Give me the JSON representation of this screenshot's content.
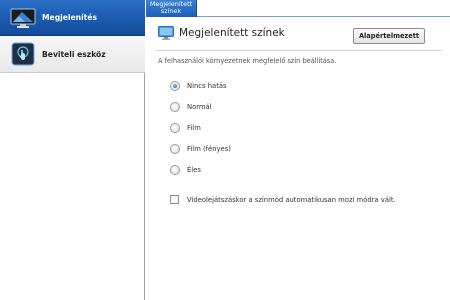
{
  "sidebar": {
    "items": [
      {
        "label": "Megjelenítés",
        "icon": "display-icon",
        "active": true
      },
      {
        "label": "Beviteli eszköz",
        "icon": "touch-input-icon",
        "active": false
      }
    ]
  },
  "tabs": [
    {
      "label_line1": "Megjelenített",
      "label_line2": "színek"
    }
  ],
  "panel": {
    "icon": "display-colors-icon",
    "title": "Megjelenített színek",
    "default_button": "Alapértelmezett",
    "description": "A felhasználói környezetnek megfelelő szín beállítása.",
    "options": [
      {
        "label": "Nincs hatás",
        "checked": true
      },
      {
        "label": "Normál",
        "checked": false
      },
      {
        "label": "Film",
        "checked": false
      },
      {
        "label": "Film (fényes)",
        "checked": false
      },
      {
        "label": "Éles",
        "checked": false
      }
    ],
    "checkbox_label": "Videolejátszáskor a színmód automatikusan mozi módra vált.",
    "checkbox_checked": false
  },
  "colors": {
    "accent": "#1f5fb3",
    "sidebar_active": "#1a5aaf",
    "divider": "#cfd6dd"
  }
}
